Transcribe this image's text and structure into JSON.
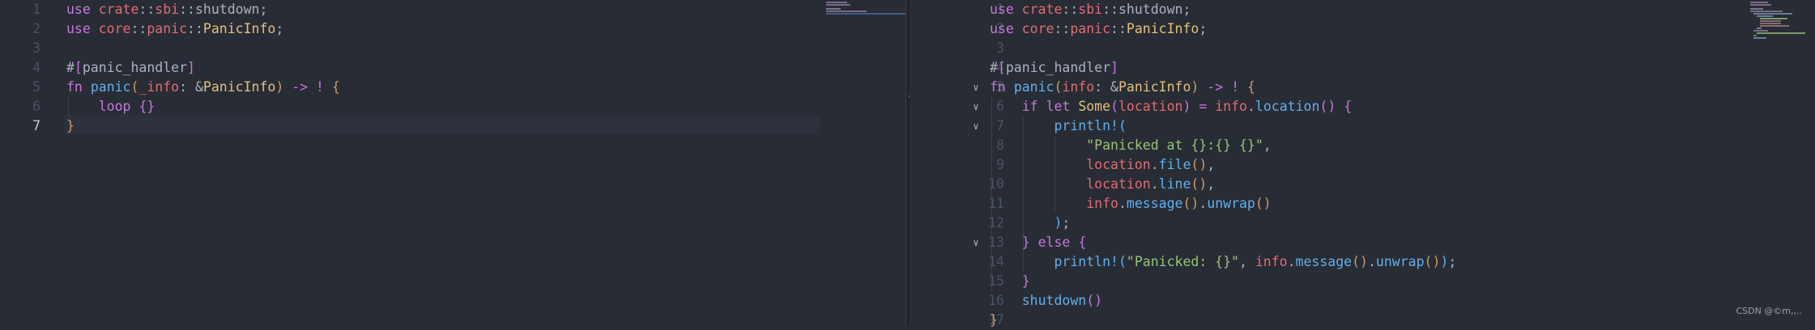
{
  "left_editor": {
    "lines": [
      {
        "num": "1",
        "tokens": [
          [
            "k",
            "use"
          ],
          [
            "p",
            " "
          ],
          [
            "v",
            "crate"
          ],
          [
            "p",
            "::"
          ],
          [
            "v",
            "sbi"
          ],
          [
            "p",
            "::"
          ],
          [
            "p",
            "shutdown;"
          ]
        ]
      },
      {
        "num": "2",
        "tokens": [
          [
            "k",
            "use"
          ],
          [
            "p",
            " "
          ],
          [
            "v",
            "core"
          ],
          [
            "p",
            "::"
          ],
          [
            "v",
            "panic"
          ],
          [
            "p",
            "::"
          ],
          [
            "t",
            "PanicInfo"
          ],
          [
            "p",
            ";"
          ]
        ]
      },
      {
        "num": "3",
        "tokens": []
      },
      {
        "num": "4",
        "tokens": [
          [
            "p",
            "#"
          ],
          [
            "bracket2",
            "["
          ],
          [
            "p",
            "panic_handler"
          ],
          [
            "bracket2",
            "]"
          ]
        ]
      },
      {
        "num": "5",
        "tokens": [
          [
            "k",
            "fn"
          ],
          [
            "p",
            " "
          ],
          [
            "f",
            "panic"
          ],
          [
            "bracket1",
            "("
          ],
          [
            "v",
            "_info"
          ],
          [
            "p",
            ": &"
          ],
          [
            "t",
            "PanicInfo"
          ],
          [
            "bracket1",
            ")"
          ],
          [
            "p",
            " "
          ],
          [
            "k",
            "->"
          ],
          [
            "p",
            " "
          ],
          [
            "k",
            "!"
          ],
          [
            "p",
            " "
          ],
          [
            "bracket1",
            "{"
          ]
        ]
      },
      {
        "num": "6",
        "tokens": [
          [
            "p",
            "    "
          ],
          [
            "k",
            "loop"
          ],
          [
            "p",
            " "
          ],
          [
            "bracket2",
            "{}"
          ]
        ]
      },
      {
        "num": "7",
        "tokens": [
          [
            "bracket1",
            "}"
          ]
        ],
        "active": true
      }
    ]
  },
  "right_editor": {
    "lines": [
      {
        "num": "1",
        "tokens": [
          [
            "k",
            "use"
          ],
          [
            "p",
            " "
          ],
          [
            "v",
            "crate"
          ],
          [
            "p",
            "::"
          ],
          [
            "v",
            "sbi"
          ],
          [
            "p",
            "::"
          ],
          [
            "p",
            "shutdown;"
          ]
        ]
      },
      {
        "num": "2",
        "tokens": [
          [
            "k",
            "use"
          ],
          [
            "p",
            " "
          ],
          [
            "v",
            "core"
          ],
          [
            "p",
            "::"
          ],
          [
            "v",
            "panic"
          ],
          [
            "p",
            "::"
          ],
          [
            "t",
            "PanicInfo"
          ],
          [
            "p",
            ";"
          ]
        ]
      },
      {
        "num": "3",
        "tokens": []
      },
      {
        "num": "4",
        "tokens": [
          [
            "p",
            "#"
          ],
          [
            "bracket2",
            "["
          ],
          [
            "p",
            "panic_handler"
          ],
          [
            "bracket2",
            "]"
          ]
        ]
      },
      {
        "num": "5",
        "fold": true,
        "tokens": [
          [
            "k",
            "fn"
          ],
          [
            "p",
            " "
          ],
          [
            "f",
            "panic"
          ],
          [
            "bracket1",
            "("
          ],
          [
            "v",
            "info"
          ],
          [
            "p",
            ": &"
          ],
          [
            "t",
            "PanicInfo"
          ],
          [
            "bracket1",
            ")"
          ],
          [
            "p",
            " "
          ],
          [
            "k",
            "->"
          ],
          [
            "p",
            " "
          ],
          [
            "k",
            "!"
          ],
          [
            "p",
            " "
          ],
          [
            "bracket1",
            "{"
          ]
        ]
      },
      {
        "num": "6",
        "fold": true,
        "tokens": [
          [
            "p",
            "    "
          ],
          [
            "k",
            "if"
          ],
          [
            "p",
            " "
          ],
          [
            "k",
            "let"
          ],
          [
            "p",
            " "
          ],
          [
            "t",
            "Some"
          ],
          [
            "bracket2",
            "("
          ],
          [
            "v",
            "location"
          ],
          [
            "bracket2",
            ")"
          ],
          [
            "p",
            " "
          ],
          [
            "k",
            "="
          ],
          [
            "p",
            " "
          ],
          [
            "v",
            "info"
          ],
          [
            "p",
            "."
          ],
          [
            "f",
            "location"
          ],
          [
            "bracket2",
            "()"
          ],
          [
            "p",
            " "
          ],
          [
            "bracket2",
            "{"
          ]
        ]
      },
      {
        "num": "7",
        "fold": true,
        "tokens": [
          [
            "p",
            "        "
          ],
          [
            "f",
            "println!"
          ],
          [
            "bracket3",
            "("
          ]
        ]
      },
      {
        "num": "8",
        "tokens": [
          [
            "p",
            "            "
          ],
          [
            "s",
            "\"Panicked at {}:{} {}\""
          ],
          [
            "p",
            ","
          ]
        ]
      },
      {
        "num": "9",
        "tokens": [
          [
            "p",
            "            "
          ],
          [
            "v",
            "location"
          ],
          [
            "p",
            "."
          ],
          [
            "f",
            "file"
          ],
          [
            "bracket1",
            "()"
          ],
          [
            "p",
            ","
          ]
        ]
      },
      {
        "num": "10",
        "tokens": [
          [
            "p",
            "            "
          ],
          [
            "v",
            "location"
          ],
          [
            "p",
            "."
          ],
          [
            "f",
            "line"
          ],
          [
            "bracket1",
            "()"
          ],
          [
            "p",
            ","
          ]
        ]
      },
      {
        "num": "11",
        "tokens": [
          [
            "p",
            "            "
          ],
          [
            "v",
            "info"
          ],
          [
            "p",
            "."
          ],
          [
            "f",
            "message"
          ],
          [
            "bracket1",
            "()"
          ],
          [
            "p",
            "."
          ],
          [
            "f",
            "unwrap"
          ],
          [
            "bracket1",
            "()"
          ]
        ]
      },
      {
        "num": "12",
        "tokens": [
          [
            "p",
            "        "
          ],
          [
            "bracket3",
            ")"
          ],
          [
            "p",
            ";"
          ]
        ]
      },
      {
        "num": "13",
        "fold": true,
        "tokens": [
          [
            "p",
            "    "
          ],
          [
            "bracket2",
            "}"
          ],
          [
            "p",
            " "
          ],
          [
            "k",
            "else"
          ],
          [
            "p",
            " "
          ],
          [
            "bracket2",
            "{"
          ]
        ]
      },
      {
        "num": "14",
        "tokens": [
          [
            "p",
            "        "
          ],
          [
            "f",
            "println!"
          ],
          [
            "bracket3",
            "("
          ],
          [
            "s",
            "\"Panicked: {}\""
          ],
          [
            "p",
            ", "
          ],
          [
            "v",
            "info"
          ],
          [
            "p",
            "."
          ],
          [
            "f",
            "message"
          ],
          [
            "bracket1",
            "()"
          ],
          [
            "p",
            "."
          ],
          [
            "f",
            "unwrap"
          ],
          [
            "bracket1",
            "()"
          ],
          [
            "bracket3",
            ")"
          ],
          [
            "p",
            ";"
          ]
        ]
      },
      {
        "num": "15",
        "tokens": [
          [
            "p",
            "    "
          ],
          [
            "bracket2",
            "}"
          ]
        ]
      },
      {
        "num": "16",
        "tokens": [
          [
            "p",
            "    "
          ],
          [
            "f",
            "shutdown"
          ],
          [
            "bracket2",
            "()"
          ]
        ]
      },
      {
        "num": "17",
        "tokens": [
          [
            "bracket1",
            "}"
          ]
        ]
      }
    ]
  },
  "watermark": "CSDN @©m,,..",
  "colors": {
    "background": "#282c34",
    "keyword": "#c678dd",
    "function": "#61afef",
    "type": "#e5c07b",
    "variable": "#e06c75",
    "string": "#98c379"
  },
  "icons": {
    "fold": "chevron-down-icon"
  }
}
